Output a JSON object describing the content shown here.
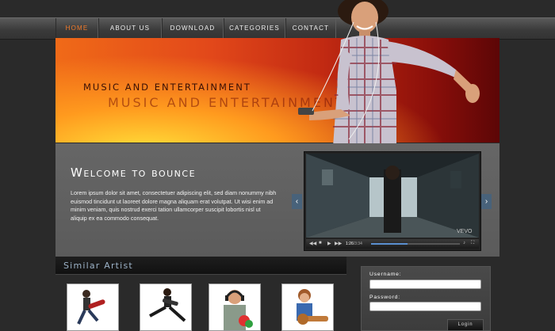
{
  "nav": {
    "items": [
      {
        "label": "HOME",
        "active": true
      },
      {
        "label": "ABOUT US",
        "active": false
      },
      {
        "label": "DOWNLOAD",
        "active": false
      },
      {
        "label": "CATEGORIES",
        "active": false
      },
      {
        "label": "CONTACT",
        "active": false
      }
    ]
  },
  "hero": {
    "title": "MUSIC AND ENTERTAINMENT",
    "reflection": "MUSIC AND ENTERTAINMENT"
  },
  "welcome": {
    "title": "Welcome to bounce",
    "body": "Lorem ipsum dolor sit amet, consectetuer adipiscing elit, sed diam nonummy nibh euismod tincidunt ut laoreet dolore magna aliquam erat volutpat. Ut wisi enim ad minim veniam, quis nostrud exerci tation ullamcorper suscipit lobortis nisl ut aliquip ex ea commodo consequat."
  },
  "video": {
    "time_current": "1:26",
    "time_total": "3:34",
    "watermark": "VEVO",
    "progress_fraction": 0.41,
    "prev_icon": "chevron-left-icon",
    "next_icon": "chevron-right-icon"
  },
  "similar": {
    "title": "Similar Artist",
    "artists": [
      {
        "icon": "guitarist-jump-icon"
      },
      {
        "icon": "guitarist-leap-icon"
      },
      {
        "icon": "headphones-dj-icon"
      },
      {
        "icon": "boy-guitar-icon"
      }
    ]
  },
  "login": {
    "username_label": "Username:",
    "password_label": "Password:",
    "username_value": "",
    "password_value": "",
    "button_label": "Login"
  },
  "colors": {
    "accent": "#f07a2a",
    "background": "#2a2a2a",
    "panel": "#5f5f5f",
    "similar_title": "#9cb2c7"
  }
}
